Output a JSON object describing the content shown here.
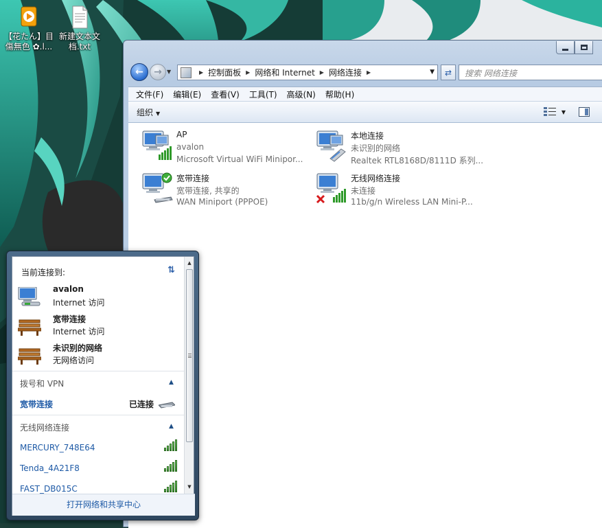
{
  "desktop": {
    "icons": [
      {
        "label": "【花たん】目傷無色 ✿.l...",
        "icon": "media-player-icon"
      },
      {
        "label": "新建文本文档.txt",
        "icon": "text-file-icon"
      }
    ]
  },
  "explorer": {
    "caption": {
      "minimize": "minimize",
      "maximize": "maximize"
    },
    "breadcrumb": [
      "控制面板",
      "网络和 Internet",
      "网络连接"
    ],
    "search_placeholder": "搜索 网络连接",
    "menu": [
      "文件(F)",
      "编辑(E)",
      "查看(V)",
      "工具(T)",
      "高级(N)",
      "帮助(H)"
    ],
    "toolbar": {
      "organize_label": "组织"
    },
    "connections": [
      {
        "name": "AP",
        "status": "avalon",
        "device": "Microsoft Virtual WiFi Minipor...",
        "icon": "wireless-adapter-icon"
      },
      {
        "name": "本地连接",
        "status": "未识别的网络",
        "device": "Realtek RTL8168D/8111D 系列...",
        "icon": "wired-adapter-icon"
      },
      {
        "name": "宽带连接",
        "status": "宽带连接, 共享的",
        "device": "WAN Miniport (PPPOE)",
        "icon": "broadband-connected-icon"
      },
      {
        "name": "无线网络连接",
        "status": "未连接",
        "device": "11b/g/n  Wireless LAN Mini-P...",
        "icon": "wireless-disconnected-icon"
      }
    ]
  },
  "flyout": {
    "header": "当前连接到:",
    "current": [
      {
        "name": "avalon",
        "access": "Internet 访问",
        "icon": "network-computer-icon"
      },
      {
        "name": "宽带连接",
        "access": "Internet 访问",
        "icon": "public-bench-icon"
      },
      {
        "name": "未识别的网络",
        "access": "无网络访问",
        "icon": "public-bench-icon"
      }
    ],
    "dialup_section": {
      "title": "拨号和 VPN",
      "items": [
        {
          "name": "宽带连接",
          "state": "已连接"
        }
      ]
    },
    "wireless_section": {
      "title": "无线网络连接",
      "networks": [
        {
          "name": "MERCURY_748E64",
          "signal": 5
        },
        {
          "name": "Tenda_4A21F8",
          "signal": 5
        },
        {
          "name": "FAST_DB015C",
          "signal": 5
        }
      ]
    },
    "footer_link": "打开网络和共享中心"
  },
  "colors": {
    "link": "#1e5aa6",
    "accent": "#2d6fd1",
    "signal": "#3aa832",
    "error": "#d7191c"
  }
}
